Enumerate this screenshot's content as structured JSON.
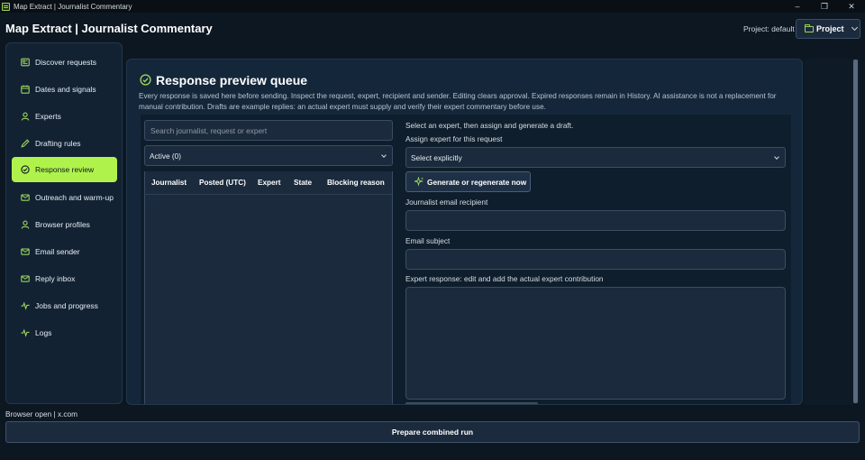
{
  "window": {
    "title": "Map Extract | Journalist Commentary"
  },
  "header": {
    "app_title": "Map Extract | Journalist Commentary",
    "project_label": "Project: default",
    "project_button": "Project"
  },
  "sidebar": {
    "items": [
      {
        "label": "Discover requests",
        "icon": "newspaper-icon"
      },
      {
        "label": "Dates and signals",
        "icon": "calendar-icon"
      },
      {
        "label": "Experts",
        "icon": "user-icon"
      },
      {
        "label": "Drafting rules",
        "icon": "pencil-icon"
      },
      {
        "label": "Response review",
        "icon": "check-circle-icon",
        "active": true
      },
      {
        "label": "Outreach and warm-up",
        "icon": "mail-icon"
      },
      {
        "label": "Browser profiles",
        "icon": "user-icon"
      },
      {
        "label": "Email sender",
        "icon": "mail-icon"
      },
      {
        "label": "Reply inbox",
        "icon": "mail-icon"
      },
      {
        "label": "Jobs and progress",
        "icon": "activity-icon"
      },
      {
        "label": "Logs",
        "icon": "activity-icon"
      }
    ]
  },
  "main": {
    "title": "Response preview queue",
    "description": "Every response is saved here before sending. Inspect the request, expert, recipient and sender. Editing clears approval. Expired responses remain in History. AI assistance is not a replacement for manual contribution. Drafts are example replies: an actual expert must supply and verify their expert commentary before use.",
    "search_placeholder": "Search journalist, request or expert",
    "filter_value": "Active (0)",
    "table_columns": [
      "Journalist",
      "Posted (UTC)",
      "Expert",
      "State",
      "Blocking reason"
    ],
    "hint": "Select an expert, then assign and generate a draft.",
    "assign_label": "Assign expert for this request",
    "assign_value": "Select explicitly",
    "generate_button": "Generate or regenerate now",
    "recipient_label": "Journalist email recipient",
    "recipient_value": "",
    "subject_label": "Email subject",
    "subject_value": "",
    "response_label": "Expert response: edit and add the actual expert contribution",
    "response_value": ""
  },
  "footer": {
    "status": "Browser open | x.com",
    "run_button": "Prepare combined run"
  },
  "colors": {
    "accent": "#b0f24c",
    "background": "#0d1722",
    "panel": "#14273a"
  }
}
